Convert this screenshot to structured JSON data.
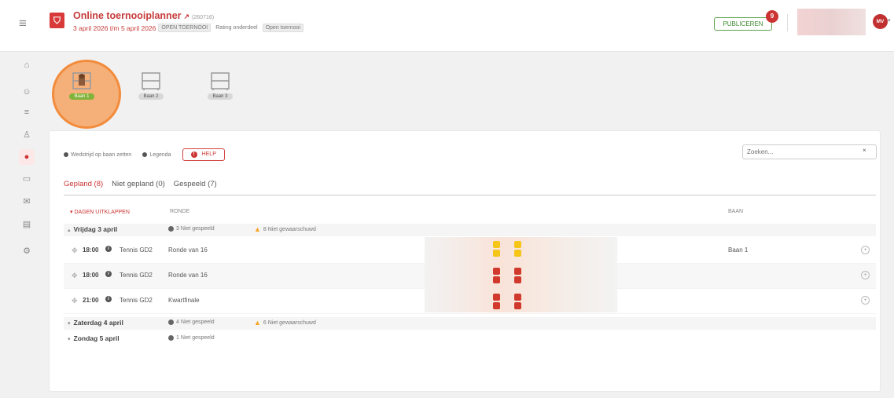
{
  "header": {
    "menu_icon": "hamburger-icon",
    "app_title": "Online toernooiplanner",
    "tournament_id": "(260716)",
    "date_range": "3 april 2026 t/m 5 april 2026",
    "tags": [
      "OPEN TOERNOOI",
      "Rating onderdeel",
      "Open toernooi"
    ],
    "publish_label": "PUBLICEREN",
    "publish_badge": "9",
    "avatar_initials": "MV"
  },
  "sidebar": {
    "items": [
      {
        "icon": "home-icon",
        "glyph": "⌂"
      },
      {
        "icon": "players-icon",
        "glyph": "☺"
      },
      {
        "icon": "list-icon",
        "glyph": "≡"
      },
      {
        "icon": "bracket-icon",
        "glyph": "♙"
      },
      {
        "icon": "planner-icon",
        "glyph": "●"
      },
      {
        "icon": "screen-icon",
        "glyph": "▭"
      },
      {
        "icon": "mail-icon",
        "glyph": "✉"
      },
      {
        "icon": "print-icon",
        "glyph": "▤"
      },
      {
        "icon": "settings-icon",
        "glyph": "⚙"
      }
    ]
  },
  "courts": [
    {
      "label": "Baan 1"
    },
    {
      "label": "Baan 2"
    },
    {
      "label": "Baan 3"
    }
  ],
  "toolbar": {
    "assign_label": "Wedstrijd op baan zetten",
    "legend_label": "Legenda",
    "help_label": "HELP",
    "search_placeholder": "Zoeken...",
    "search_clear": "×"
  },
  "tabs": [
    {
      "label": "Gepland (8)"
    },
    {
      "label": "Niet gepland (0)"
    },
    {
      "label": "Gespeeld (7)"
    }
  ],
  "table": {
    "expand_all": "DAGEN UITKLAPPEN",
    "col_round": "RONDE",
    "col_court": "BAAN",
    "days": [
      {
        "title": "Vrijdag 3 april",
        "not_played": "3 Niet gespeeld",
        "not_notified": "8 Niet gewaarschuwd"
      },
      {
        "title": "Zaterdag 4 april",
        "not_played": "4 Niet gespeeld",
        "not_notified": "6 Niet gewaarschuwd"
      },
      {
        "title": "Zondag 5 april",
        "not_played": "1 Niet gespeeld"
      }
    ],
    "matches": [
      {
        "time": "18:00",
        "category": "Tennis GD2",
        "round": "Ronde van 16",
        "court": "Baan 1"
      },
      {
        "time": "18:00",
        "category": "Tennis GD2",
        "round": "Ronde van 16",
        "court": ""
      },
      {
        "time": "21:00",
        "category": "Tennis GD2",
        "round": "Kwartfinale",
        "court": ""
      }
    ]
  },
  "colors": {
    "brand_red": "#c63a3a",
    "publish_green": "#3d8a2f",
    "selected_orange": "#f28c3c",
    "status_yellow": "#f5c518",
    "status_red": "#d0392b"
  }
}
